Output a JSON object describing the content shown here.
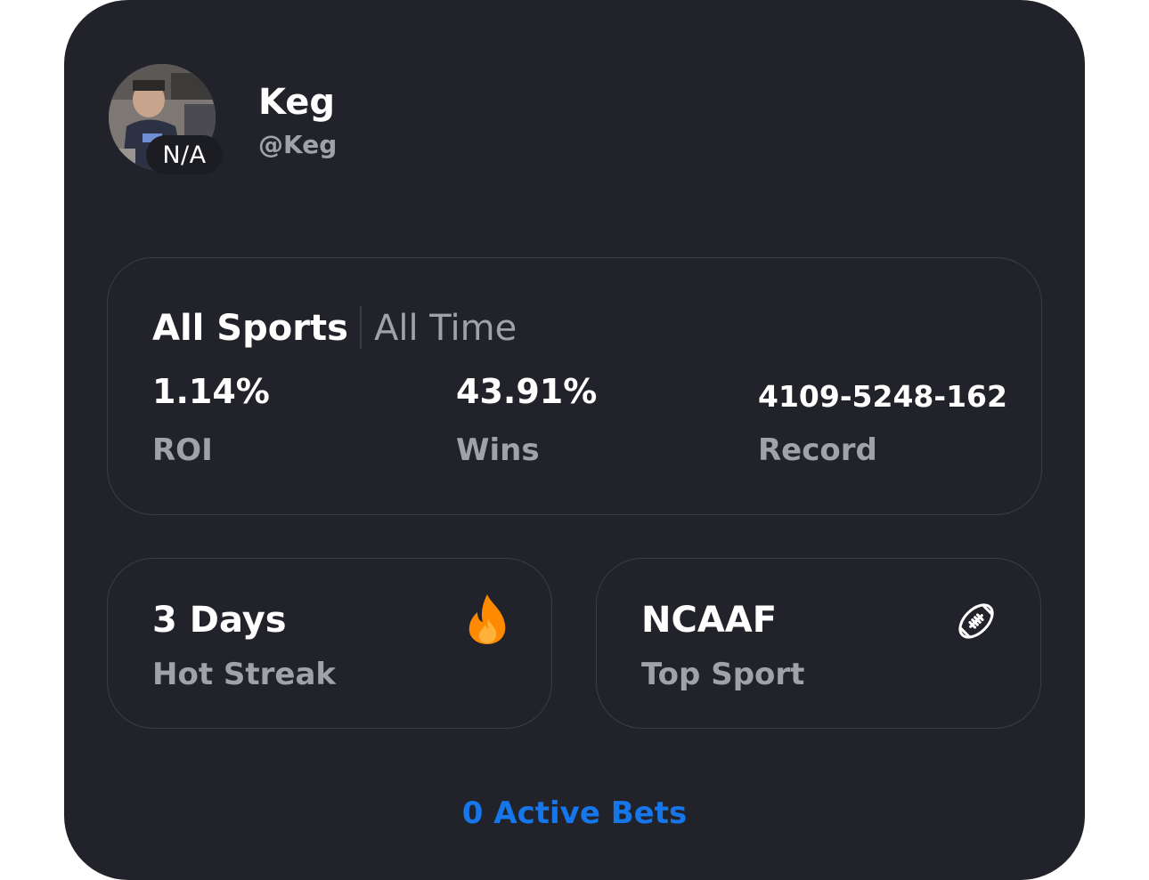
{
  "profile": {
    "display_name": "Keg",
    "username": "@Keg",
    "rank_badge": "N/A"
  },
  "stats": {
    "filter_sport": "All Sports",
    "filter_time": "All Time",
    "roi_value": "1.14%",
    "roi_label": "ROI",
    "wins_value": "43.91%",
    "wins_label": "Wins",
    "record_value": "4109-5248-162",
    "record_label": "Record"
  },
  "streak": {
    "value": "3 Days",
    "label": "Hot Streak",
    "icon": "fire-icon"
  },
  "top_sport": {
    "value": "NCAAF",
    "label": "Top Sport",
    "icon": "football-icon"
  },
  "active_bets_link": "0 Active Bets",
  "colors": {
    "card_bg": "#22232a",
    "border": "#3b3c44",
    "text_primary": "#ffffff",
    "text_secondary": "#a1a2a8",
    "accent_blue": "#1677ea",
    "fire_orange": "#ff8a00"
  }
}
